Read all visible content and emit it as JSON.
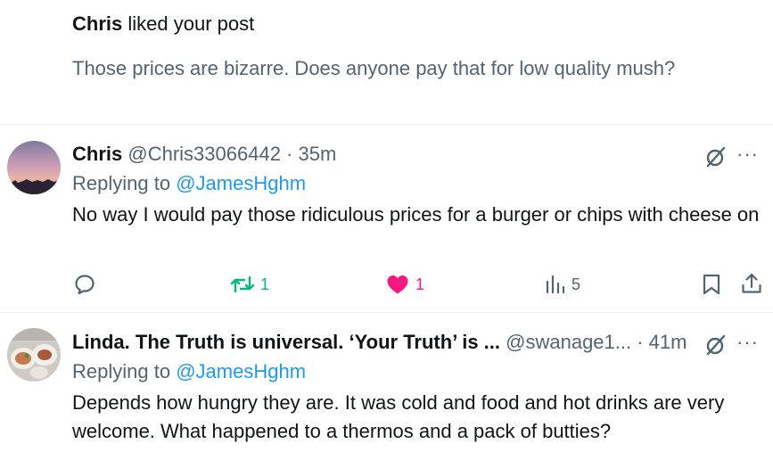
{
  "notification": {
    "user": "Chris",
    "action": "liked your post",
    "preview": "Those prices are bizarre.  Does anyone pay that for low quality mush?"
  },
  "posts": [
    {
      "display_name": "Chris",
      "handle_meta": "@Chris33066442 · 35m",
      "replying_prefix": "Replying to",
      "replying_handle": "@JamesHghm",
      "text": "No way I would pay those ridiculous prices for a burger or chips with cheese on",
      "avatar_icon": "sunset-avatar",
      "actions": {
        "reply": "",
        "repost": "1",
        "like": "1",
        "views": "5"
      }
    },
    {
      "display_name": "Linda. The Truth is universal. ‘Your Truth’ is ...",
      "handle_meta": "@swanage1... · 41m",
      "replying_prefix": "Replying to",
      "replying_handle": "@JamesHghm",
      "text": "Depends how hungry they are. It was cold and food and hot drinks are very welcome. What happened to a thermos and a pack of butties?",
      "avatar_icon": "food-plates-avatar"
    }
  ],
  "more_label": "···",
  "colors": {
    "text": "#0f1419",
    "muted": "#536471",
    "link": "#1d9bf0",
    "repost": "#00ba7c",
    "like": "#f91880"
  }
}
